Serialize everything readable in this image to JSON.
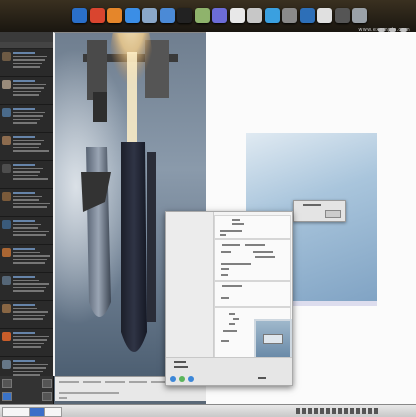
{
  "dock": {
    "icons": [
      "finder-icon",
      "chrome-icon",
      "firefox-icon",
      "tweetdeck-icon",
      "safari-icon",
      "mail-icon",
      "terminal-icon",
      "photos-icon",
      "itunes-icon",
      "calendar-icon",
      "preview-icon",
      "skype-icon",
      "system-prefs-icon",
      "dashboard-icon",
      "textedit-icon",
      "console-icon",
      "trash-icon"
    ],
    "colors": [
      "#2a6fc9",
      "#d9452f",
      "#e5862a",
      "#3b8ee6",
      "#8aa7c8",
      "#4b8ad6",
      "#222222",
      "#8fb36c",
      "#6c6cd8",
      "#e8e8e8",
      "#c7c7c7",
      "#3aa0e0",
      "#8a8a8a",
      "#2d6fb8",
      "#e0e0e0",
      "#555555",
      "#9aa1a8"
    ]
  },
  "site_label": "www.example.com",
  "taskbar": {
    "start_label": "",
    "clock": "",
    "items": [
      "",
      "",
      ""
    ]
  },
  "twitter": {
    "header": "",
    "avatar_colors": [
      "#6d5a44",
      "#9a8b7a",
      "#4a6a8a",
      "#8c6b4e",
      "#4d4d4d",
      "#7a5a3a",
      "#3a5a7a",
      "#aa6633",
      "#556677",
      "#886644",
      "#c85d2a",
      "#667788",
      "#bb9977"
    ]
  }
}
